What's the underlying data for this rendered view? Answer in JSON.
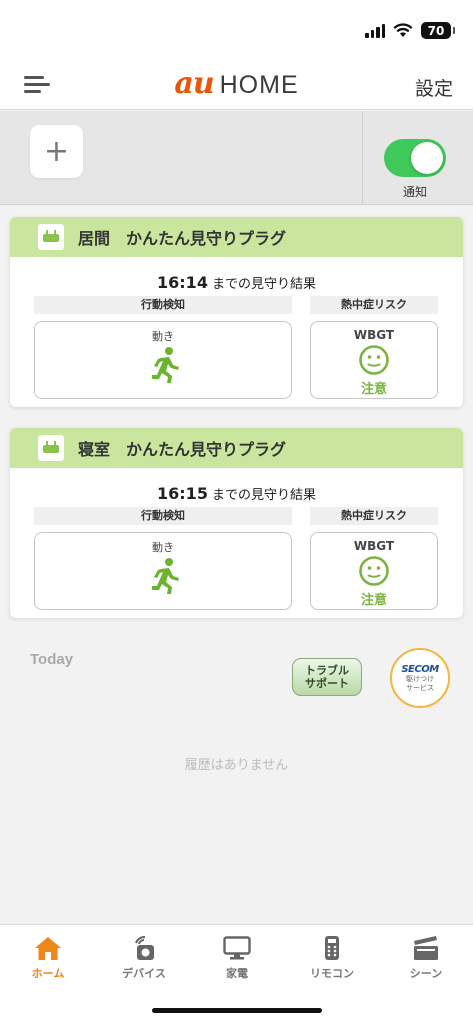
{
  "status_bar": {
    "battery": "70"
  },
  "header": {
    "logo_au": "au",
    "logo_home": "HOME",
    "settings_label": "設定"
  },
  "quick_bar": {
    "add_symbol": "+",
    "notify_label": "通知",
    "notify_enabled": true
  },
  "cards": [
    {
      "room": "居間",
      "device": "かんたん見守りプラグ",
      "time": "16:14",
      "time_suffix": "までの見守り結果",
      "activity_label": "行動検知",
      "heat_label": "熱中症リスク",
      "activity_caption": "動き",
      "heat_caption": "WBGT",
      "heat_status": "注意"
    },
    {
      "room": "寝室",
      "device": "かんたん見守りプラグ",
      "time": "16:15",
      "time_suffix": "までの見守り結果",
      "activity_label": "行動検知",
      "heat_label": "熱中症リスク",
      "activity_caption": "動き",
      "heat_caption": "WBGT",
      "heat_status": "注意"
    }
  ],
  "today": {
    "label": "Today",
    "trouble_line1": "トラブル",
    "trouble_line2": "サポート",
    "secom_logo": "SECOM",
    "secom_line1": "駆けつけ",
    "secom_line2": "サービス",
    "empty_message": "履歴はありません"
  },
  "tabs": [
    {
      "label": "ホーム",
      "icon": "home-icon",
      "active": true
    },
    {
      "label": "デバイス",
      "icon": "device-icon",
      "active": false
    },
    {
      "label": "家電",
      "icon": "appliance-icon",
      "active": false
    },
    {
      "label": "リモコン",
      "icon": "remote-icon",
      "active": false
    },
    {
      "label": "シーン",
      "icon": "scene-icon",
      "active": false
    }
  ],
  "colors": {
    "accent": "#f08519",
    "card_header": "#c9e59e",
    "status_green": "#7cb342",
    "toggle_on": "#3ec95a"
  }
}
